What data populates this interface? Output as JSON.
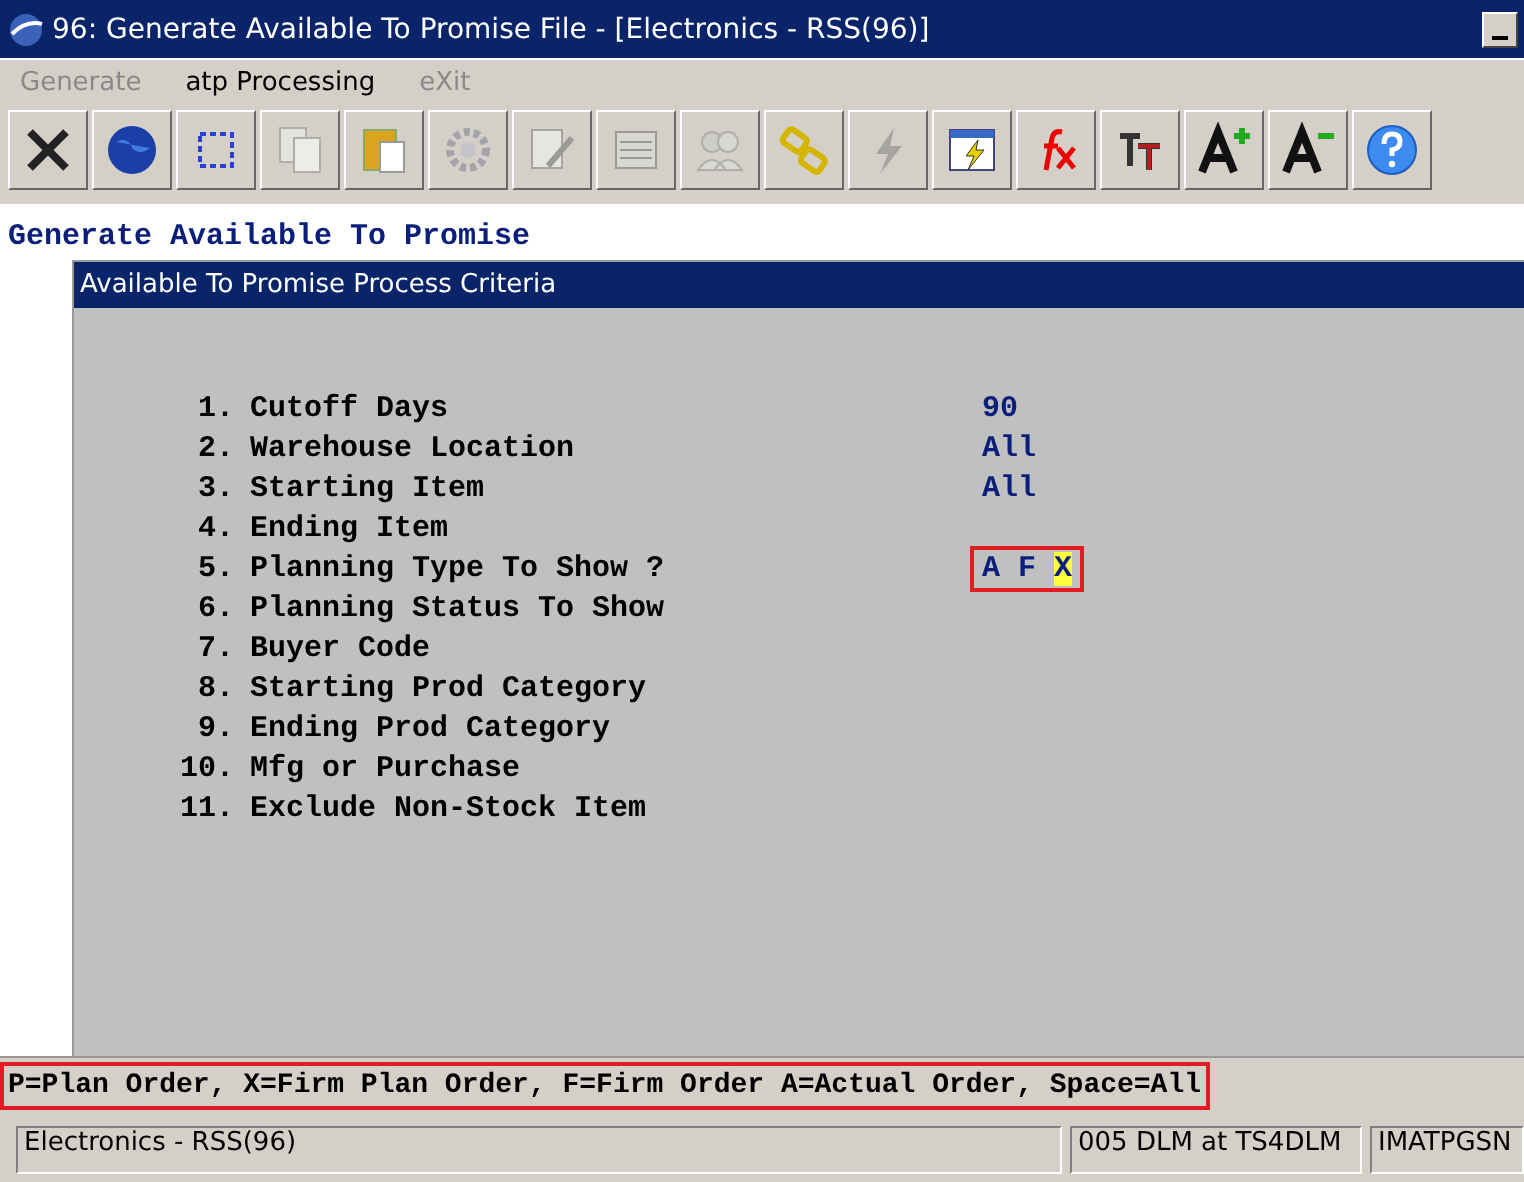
{
  "window": {
    "title": "96: Generate Available To Promise File - [Electronics - RSS(96)]"
  },
  "menu": [
    {
      "label": "Generate",
      "disabled": true
    },
    {
      "label": "atp Processing",
      "disabled": false
    },
    {
      "label": "eXit",
      "disabled": true
    }
  ],
  "toolbar": [
    {
      "kind": "close",
      "disabled": false
    },
    {
      "kind": "globe",
      "disabled": false
    },
    {
      "kind": "select",
      "disabled": false
    },
    {
      "kind": "copy",
      "disabled": true
    },
    {
      "kind": "paste",
      "disabled": false
    },
    {
      "kind": "gear",
      "disabled": true
    },
    {
      "kind": "edit",
      "disabled": true
    },
    {
      "kind": "list",
      "disabled": true
    },
    {
      "kind": "users",
      "disabled": true
    },
    {
      "kind": "link",
      "disabled": false
    },
    {
      "kind": "bolt",
      "disabled": true
    },
    {
      "kind": "run",
      "disabled": false
    },
    {
      "kind": "fx",
      "disabled": false
    },
    {
      "kind": "font",
      "disabled": false
    },
    {
      "kind": "bigger",
      "disabled": false
    },
    {
      "kind": "smaller",
      "disabled": false
    },
    {
      "kind": "help",
      "disabled": false
    }
  ],
  "heading": "Generate Available To Promise",
  "panel": {
    "title": "Available To Promise Process Criteria",
    "rows": [
      {
        "number": "1.",
        "label": "Cutoff Days",
        "value": "90",
        "focused": false
      },
      {
        "number": "2.",
        "label": "Warehouse Location",
        "value": "All",
        "focused": false
      },
      {
        "number": "3.",
        "label": "Starting Item",
        "value": "All",
        "focused": false
      },
      {
        "number": "4.",
        "label": "Ending Item",
        "focused": false
      },
      {
        "number": "5.",
        "label": "Planning Type To Show ?",
        "value": "A F",
        "cursor": "X",
        "focused": true
      },
      {
        "number": "6.",
        "label": "Planning Status To Show",
        "focused": false
      },
      {
        "number": "7.",
        "label": "Buyer Code",
        "focused": false
      },
      {
        "number": "8.",
        "label": "Starting Prod Category",
        "focused": false
      },
      {
        "number": "9.",
        "label": "Ending Prod Category",
        "focused": false
      },
      {
        "number": "10.",
        "label": "Mfg or Purchase",
        "focused": false
      },
      {
        "number": "11.",
        "label": "Exclude Non-Stock Item",
        "focused": false
      }
    ]
  },
  "hint": "P=Plan Order, X=Firm Plan Order, F=Firm Order A=Actual Order, Space=All",
  "status_bar": [
    "Electronics - RSS(96)",
    "005 DLM at TS4DLM",
    "IMATPGSN"
  ]
}
